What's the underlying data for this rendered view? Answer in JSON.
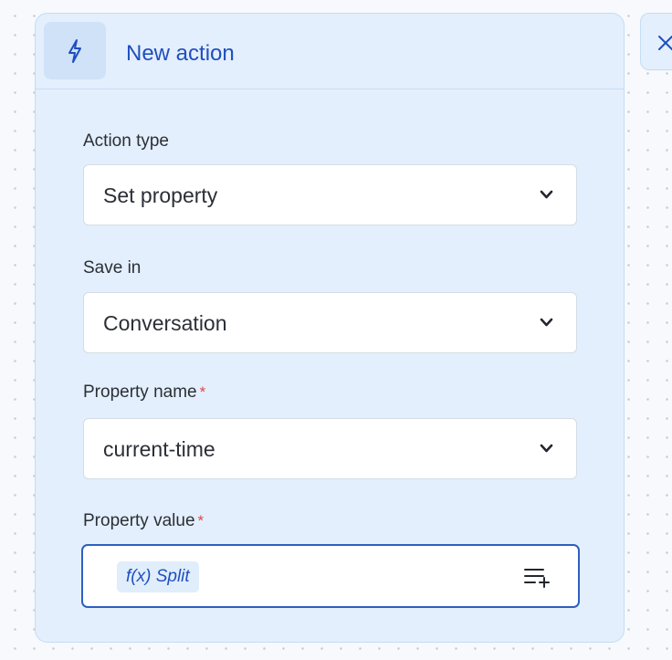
{
  "panel": {
    "title": "New action",
    "header_icon": "lightning-bolt-icon"
  },
  "fields": {
    "action_type": {
      "label": "Action type",
      "value": "Set property"
    },
    "save_in": {
      "label": "Save in",
      "value": "Conversation"
    },
    "property_name": {
      "label": "Property name",
      "required_mark": "*",
      "value": "current-time"
    },
    "property_value": {
      "label": "Property value",
      "required_mark": "*",
      "function_chip": "f(x) Split",
      "insert_icon": "list-add-icon"
    }
  },
  "side_tab": {
    "icon": "close-icon"
  },
  "colors": {
    "accent": "#1f4fbf",
    "card_bg": "#e3effc",
    "required": "#e04a4a",
    "focus_border": "#2d5fbf"
  }
}
